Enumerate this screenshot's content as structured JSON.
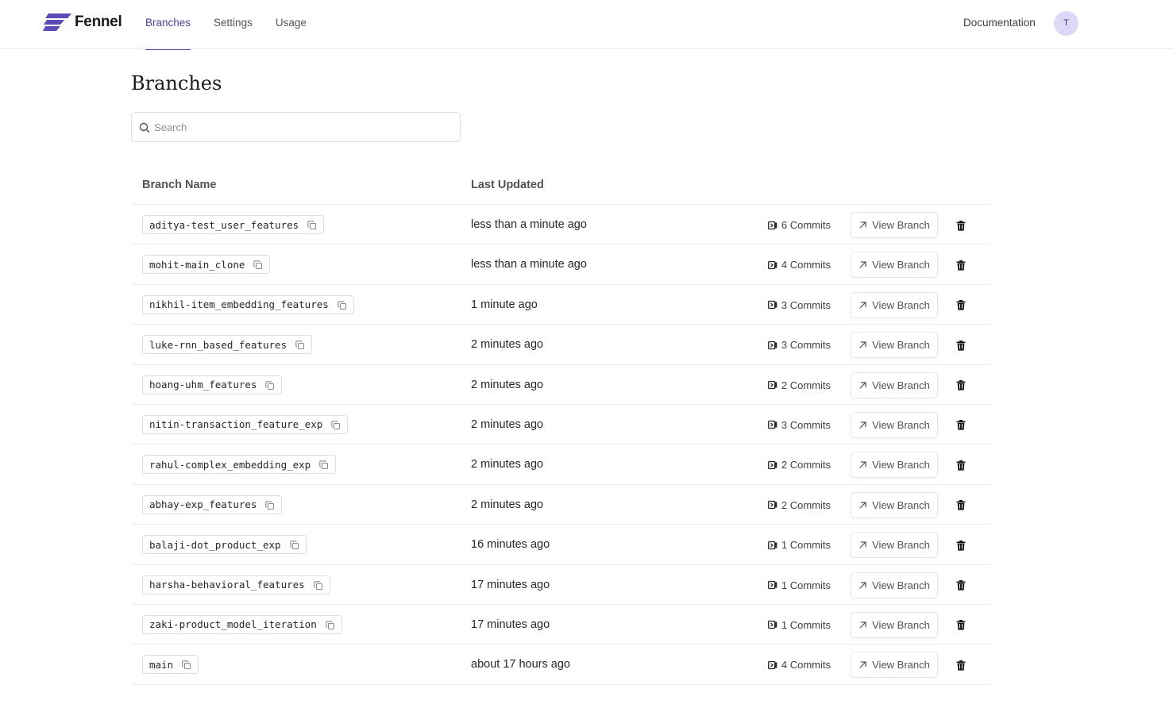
{
  "app": {
    "name": "Fennel"
  },
  "nav": [
    {
      "label": "Branches",
      "active": true
    },
    {
      "label": "Settings",
      "active": false
    },
    {
      "label": "Usage",
      "active": false
    }
  ],
  "header": {
    "documentation_label": "Documentation",
    "avatar_initial": "T"
  },
  "page": {
    "title": "Branches"
  },
  "search": {
    "placeholder": "Search",
    "value": ""
  },
  "table": {
    "columns": [
      "Branch Name",
      "Last Updated"
    ],
    "view_label": "View Branch",
    "rows": [
      {
        "name": "aditya-test_user_features",
        "updated": "less than a minute ago",
        "commits": "6 Commits"
      },
      {
        "name": "mohit-main_clone",
        "updated": "less than a minute ago",
        "commits": "4 Commits"
      },
      {
        "name": "nikhil-item_embedding_features",
        "updated": "1 minute ago",
        "commits": "3 Commits"
      },
      {
        "name": "luke-rnn_based_features",
        "updated": "2 minutes ago",
        "commits": "3 Commits"
      },
      {
        "name": "hoang-uhm_features",
        "updated": "2 minutes ago",
        "commits": "2 Commits"
      },
      {
        "name": "nitin-transaction_feature_exp",
        "updated": "2 minutes ago",
        "commits": "3 Commits"
      },
      {
        "name": "rahul-complex_embedding_exp",
        "updated": "2 minutes ago",
        "commits": "2 Commits"
      },
      {
        "name": "abhay-exp_features",
        "updated": "2 minutes ago",
        "commits": "2 Commits"
      },
      {
        "name": "balaji-dot_product_exp",
        "updated": "16 minutes ago",
        "commits": "1 Commits"
      },
      {
        "name": "harsha-behavioral_features",
        "updated": "17 minutes ago",
        "commits": "1 Commits"
      },
      {
        "name": "zaki-product_model_iteration",
        "updated": "17 minutes ago",
        "commits": "1 Commits"
      },
      {
        "name": "main",
        "updated": "about 17 hours ago",
        "commits": "4 Commits"
      }
    ]
  },
  "icons": {
    "logo": "fennel-logo-icon",
    "search": "search-icon",
    "copy": "copy-icon",
    "commit": "commit-icon",
    "view": "arrow-up-right-icon",
    "delete": "trash-icon"
  },
  "colors": {
    "accent": "#5b4bb5",
    "avatar_bg": "#ddd8f6"
  }
}
